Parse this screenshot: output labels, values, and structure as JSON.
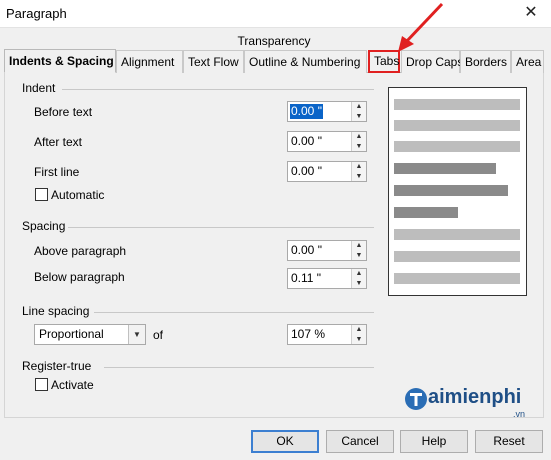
{
  "window": {
    "title": "Paragraph",
    "close_glyph": "✕"
  },
  "tabs": {
    "row1": [
      "Transparency"
    ],
    "row2": [
      "Indents & Spacing",
      "Alignment",
      "Text Flow",
      "Outline & Numbering",
      "Tabs",
      "Drop Caps",
      "Borders",
      "Area"
    ],
    "active": "Indents & Spacing",
    "highlighted": "Tabs"
  },
  "indent": {
    "title": "Indent",
    "before_text": {
      "label": "Before text",
      "value": "0.00 \""
    },
    "after_text": {
      "label": "After text",
      "value": "0.00 \""
    },
    "first_line": {
      "label": "First line",
      "value": "0.00 \""
    },
    "automatic": {
      "label": "Automatic",
      "checked": false
    }
  },
  "spacing": {
    "title": "Spacing",
    "above": {
      "label": "Above paragraph",
      "value": "0.00 \""
    },
    "below": {
      "label": "Below paragraph",
      "value": "0.11 \""
    }
  },
  "line_spacing": {
    "title": "Line spacing",
    "mode": "Proportional",
    "of_label": "of",
    "value": "107 %"
  },
  "register_true": {
    "title": "Register-true",
    "activate": {
      "label": "Activate",
      "checked": false
    }
  },
  "buttons": {
    "ok": "OK",
    "cancel": "Cancel",
    "help": "Help",
    "reset": "Reset"
  },
  "watermark": {
    "text": "aimienphi",
    "suffix": ".vn"
  },
  "colors": {
    "highlight_border": "#e02020",
    "selection": "#0a64c8",
    "preview_bar_light": "#bdbdbd",
    "preview_bar_dark": "#8a8a8a"
  }
}
